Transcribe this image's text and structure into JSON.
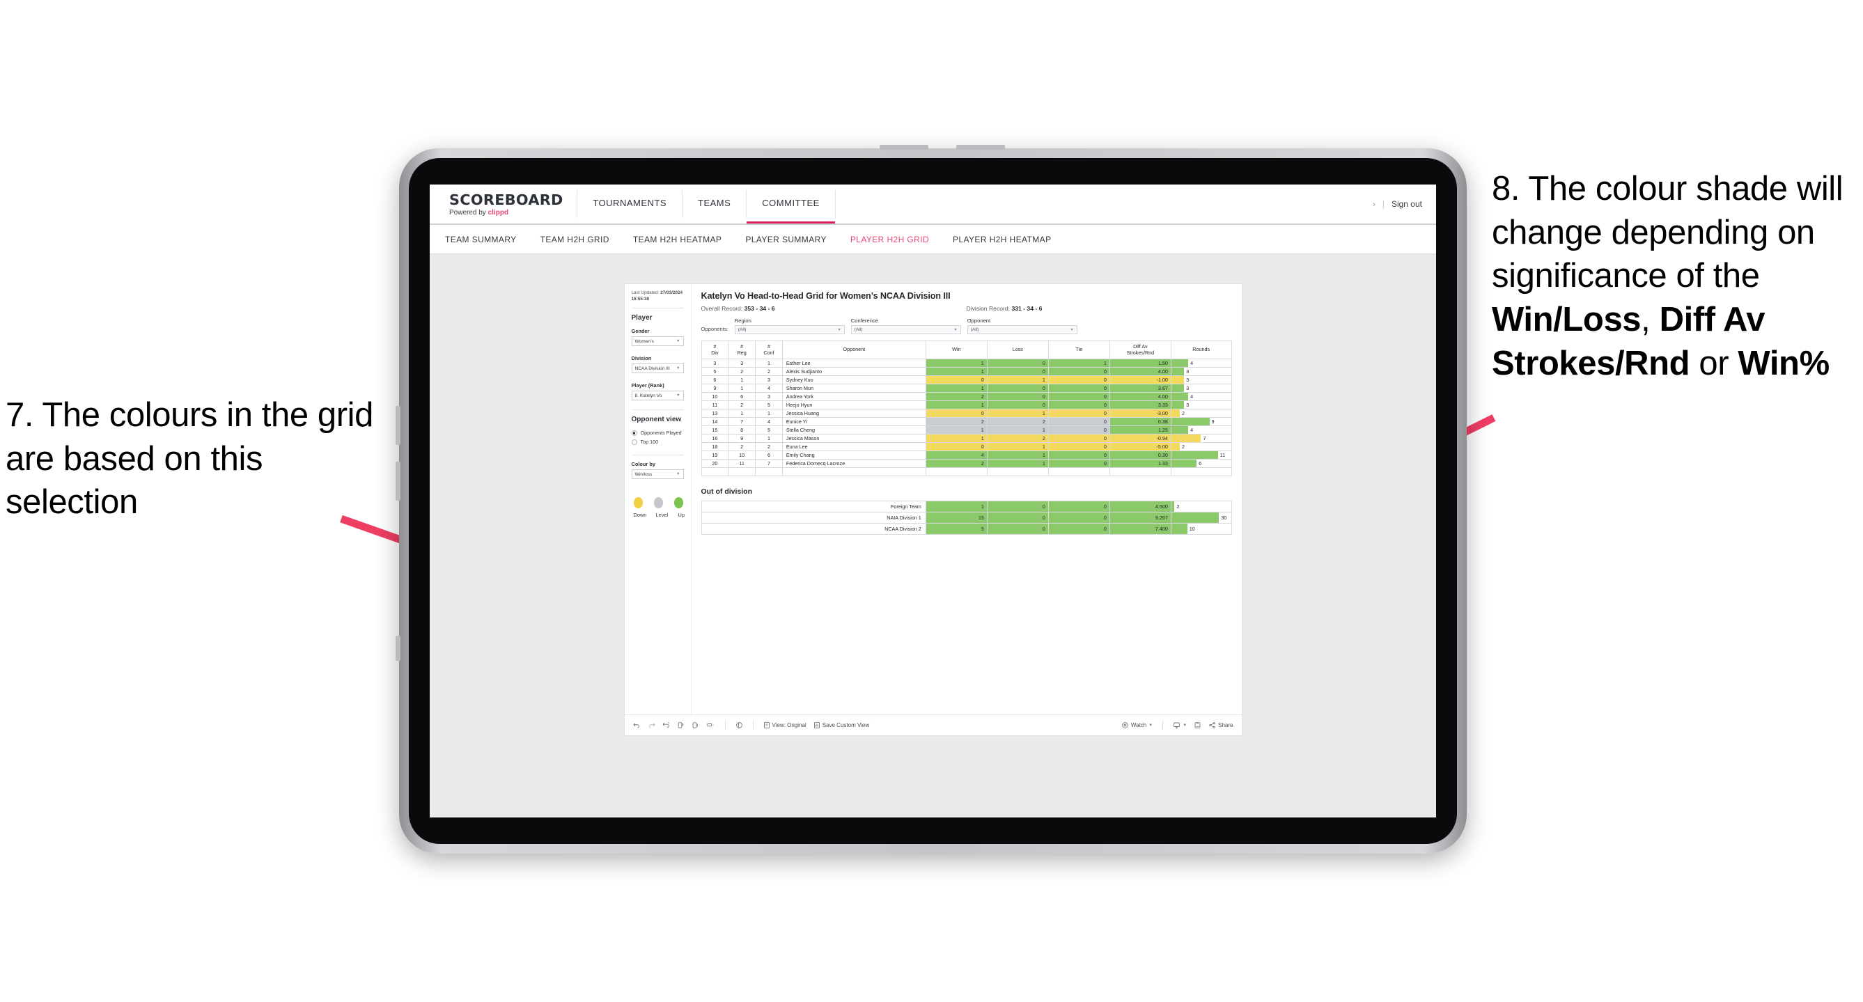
{
  "annotations": {
    "left": {
      "id": "7.",
      "text": "7. The colours in the grid are based on this selection"
    },
    "right": {
      "pre": "8. The colour shade will change depending on significance of the ",
      "b1": "Win/Loss",
      "mid1": ", ",
      "b2": "Diff Av Strokes/Rnd",
      "mid2": " or ",
      "b3": "Win%"
    },
    "arrow_color": "#ef3e64"
  },
  "app": {
    "brand": {
      "name": "SCOREBOARD",
      "powered_prefix": "Powered by ",
      "powered_brand": "clippd"
    },
    "main_nav": [
      {
        "label": "TOURNAMENTS",
        "active": false
      },
      {
        "label": "TEAMS",
        "active": false
      },
      {
        "label": "COMMITTEE",
        "active": true
      }
    ],
    "header_right": {
      "chevron": "›",
      "divider": "|",
      "sign_out": "Sign out"
    },
    "sub_nav": [
      {
        "label": "TEAM SUMMARY",
        "active": false
      },
      {
        "label": "TEAM H2H GRID",
        "active": false
      },
      {
        "label": "TEAM H2H HEATMAP",
        "active": false
      },
      {
        "label": "PLAYER SUMMARY",
        "active": false
      },
      {
        "label": "PLAYER H2H GRID",
        "active": true
      },
      {
        "label": "PLAYER H2H HEATMAP",
        "active": false
      }
    ]
  },
  "sidebar": {
    "last_updated_label": "Last Updated: ",
    "last_updated_value": "27/03/2024 16:55:38",
    "player_heading": "Player",
    "fields": [
      {
        "label": "Gender",
        "value": "Women’s"
      },
      {
        "label": "Division",
        "value": "NCAA Division III"
      },
      {
        "label": "Player (Rank)",
        "value": "8. Katelyn Vo"
      }
    ],
    "opponent_view": {
      "heading": "Opponent view",
      "options": [
        {
          "label": "Opponents Played",
          "selected": true
        },
        {
          "label": "Top 100",
          "selected": false
        }
      ]
    },
    "colour_by": {
      "label": "Colour by",
      "value": "Win/loss"
    },
    "legend": [
      {
        "label": "Down",
        "color": "#f0d044"
      },
      {
        "label": "Level",
        "color": "#c4c7cb"
      },
      {
        "label": "Up",
        "color": "#7cc24f"
      }
    ]
  },
  "viz": {
    "title": "Katelyn Vo Head-to-Head Grid for Women’s NCAA Division III",
    "overall_record_label": "Overall Record: ",
    "overall_record_value": "353 -  34 - 6",
    "division_record_label": "Division Record: ",
    "division_record_value": "331 -  34 - 6",
    "opponents_label": "Opponents:",
    "opponent_filters": [
      {
        "caption": "Region",
        "value": "(All)"
      },
      {
        "caption": "Conference",
        "value": "(All)"
      },
      {
        "caption": "Opponent",
        "value": "(All)"
      }
    ],
    "out_of_division_title": "Out of division"
  },
  "chart_data": {
    "type": "table",
    "title": "Katelyn Vo Head-to-Head Grid for Women’s NCAA Division III",
    "columns": [
      "# Div",
      "# Reg",
      "# Conf",
      "Opponent",
      "Win",
      "Loss",
      "Tie",
      "Diff Av Strokes/Rnd",
      "Rounds"
    ],
    "column_headers_two_line": [
      {
        "l1": "#",
        "l2": "Div"
      },
      {
        "l1": "#",
        "l2": "Reg"
      },
      {
        "l1": "#",
        "l2": "Conf"
      },
      {
        "l1": "Opponent",
        "l2": ""
      },
      {
        "l1": "Win",
        "l2": ""
      },
      {
        "l1": "Loss",
        "l2": ""
      },
      {
        "l1": "Tie",
        "l2": ""
      },
      {
        "l1": "Diff Av",
        "l2": "Strokes/Rnd"
      },
      {
        "l1": "Rounds",
        "l2": ""
      }
    ],
    "colors": {
      "up": "#8bc96a",
      "down": "#f3da5e",
      "level": "#c9ccd0",
      "white": "#ffffff"
    },
    "rounds_max": 11,
    "rows": [
      {
        "div": "3",
        "reg": "3",
        "conf": "1",
        "opponent": "Esther Lee",
        "win": "1",
        "loss": "0",
        "tie": "1",
        "diff": "1.50",
        "rounds": "4",
        "shade": "up"
      },
      {
        "div": "5",
        "reg": "2",
        "conf": "2",
        "opponent": "Alexis Sudjianto",
        "win": "1",
        "loss": "0",
        "tie": "0",
        "diff": "4.00",
        "rounds": "3",
        "shade": "up"
      },
      {
        "div": "6",
        "reg": "1",
        "conf": "3",
        "opponent": "Sydney Kuo",
        "win": "0",
        "loss": "1",
        "tie": "0",
        "diff": "-1.00",
        "rounds": "3",
        "shade": "down"
      },
      {
        "div": "9",
        "reg": "1",
        "conf": "4",
        "opponent": "Sharon Mun",
        "win": "1",
        "loss": "0",
        "tie": "0",
        "diff": "3.67",
        "rounds": "3",
        "shade": "up"
      },
      {
        "div": "10",
        "reg": "6",
        "conf": "3",
        "opponent": "Andrea York",
        "win": "2",
        "loss": "0",
        "tie": "0",
        "diff": "4.00",
        "rounds": "4",
        "shade": "up"
      },
      {
        "div": "11",
        "reg": "2",
        "conf": "5",
        "opponent": "Heejo Hyun",
        "win": "1",
        "loss": "0",
        "tie": "0",
        "diff": "3.33",
        "rounds": "3",
        "shade": "up"
      },
      {
        "div": "13",
        "reg": "1",
        "conf": "1",
        "opponent": "Jessica Huang",
        "win": "0",
        "loss": "1",
        "tie": "0",
        "diff": "-3.00",
        "rounds": "2",
        "shade": "down"
      },
      {
        "div": "14",
        "reg": "7",
        "conf": "4",
        "opponent": "Eunice Yi",
        "win": "2",
        "loss": "2",
        "tie": "0",
        "diff": "0.38",
        "rounds": "9",
        "shade": "level",
        "diff_shade": "up"
      },
      {
        "div": "15",
        "reg": "8",
        "conf": "5",
        "opponent": "Stella Cheng",
        "win": "1",
        "loss": "1",
        "tie": "0",
        "diff": "1.25",
        "rounds": "4",
        "shade": "level",
        "diff_shade": "up"
      },
      {
        "div": "16",
        "reg": "9",
        "conf": "1",
        "opponent": "Jessica Mason",
        "win": "1",
        "loss": "2",
        "tie": "0",
        "diff": "-0.94",
        "rounds": "7",
        "shade": "down"
      },
      {
        "div": "18",
        "reg": "2",
        "conf": "2",
        "opponent": "Euna Lee",
        "win": "0",
        "loss": "1",
        "tie": "0",
        "diff": "-5.00",
        "rounds": "2",
        "shade": "down"
      },
      {
        "div": "19",
        "reg": "10",
        "conf": "6",
        "opponent": "Emily Chang",
        "win": "4",
        "loss": "1",
        "tie": "0",
        "diff": "0.30",
        "rounds": "11",
        "shade": "up"
      },
      {
        "div": "20",
        "reg": "11",
        "conf": "7",
        "opponent": "Federica Domecq Lacroze",
        "win": "2",
        "loss": "1",
        "tie": "0",
        "diff": "1.33",
        "rounds": "6",
        "shade": "up"
      }
    ],
    "out_of_division": {
      "rounds_max": 30,
      "rows": [
        {
          "name": "Foreign Team",
          "win": "1",
          "loss": "0",
          "tie": "0",
          "diff": "4.500",
          "rounds": "2",
          "shade": "up"
        },
        {
          "name": "NAIA Division 1",
          "win": "15",
          "loss": "0",
          "tie": "0",
          "diff": "9.267",
          "rounds": "30",
          "shade": "up"
        },
        {
          "name": "NCAA Division 2",
          "win": "5",
          "loss": "0",
          "tie": "0",
          "diff": "7.400",
          "rounds": "10",
          "shade": "up"
        }
      ]
    }
  },
  "toolbar": {
    "undo": "undo-icon",
    "redo": "redo-icon",
    "revert": "revert-icon",
    "refresh": "refresh-icon",
    "pause": "pause-icon",
    "rect": "rect-icon",
    "highlight": "highlight-icon",
    "view_label": "View: Original",
    "save_label": "Save Custom View",
    "watch_label": "Watch",
    "share_label": "Share"
  }
}
